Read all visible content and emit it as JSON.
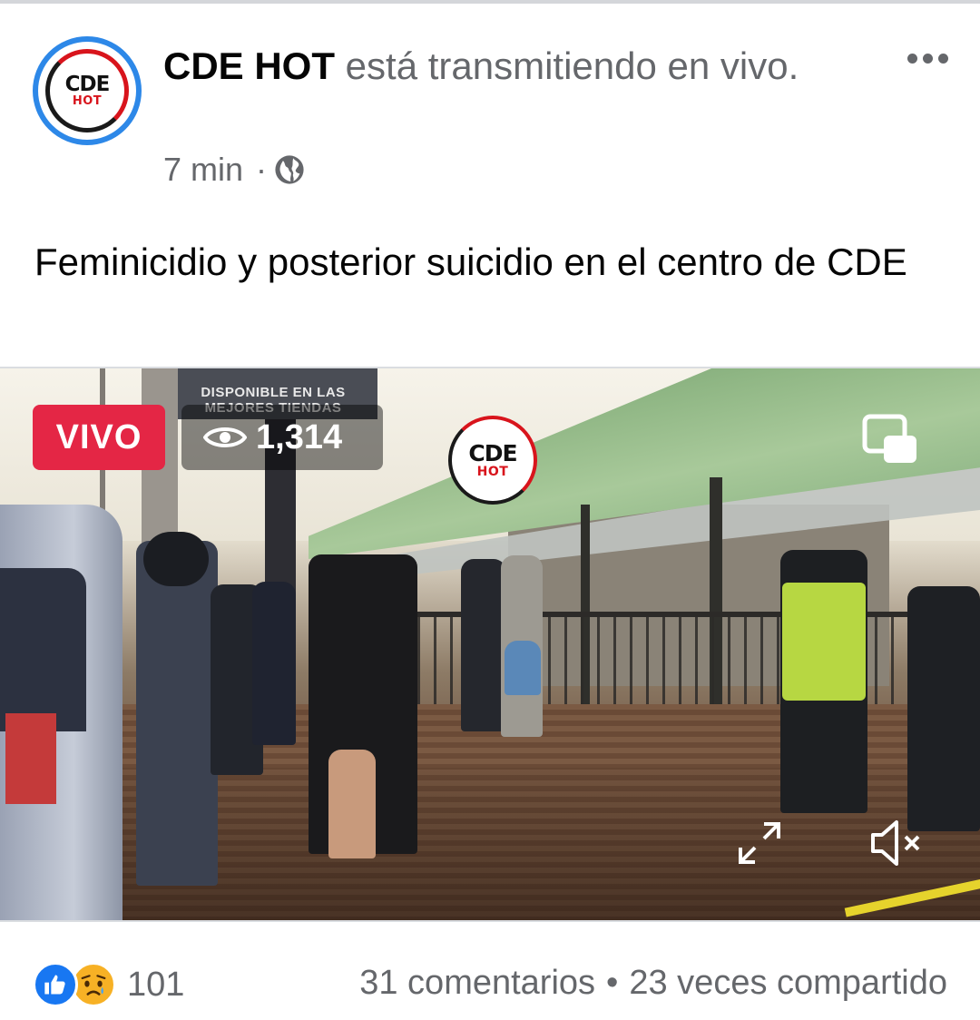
{
  "post": {
    "page_name": "CDE HOT",
    "status_text": " está transmitiendo en vivo.",
    "time": "7 min",
    "separator": "·",
    "privacy_icon": "globe-icon",
    "text": "Feminicidio y posterior suicidio en el centro de CDE",
    "avatar_logo": {
      "main": "CDE",
      "sub": "HOT"
    }
  },
  "video": {
    "live_label": "VIVO",
    "viewer_count": "1,314",
    "billboard_text": "DISPONIBLE EN LAS MEJORES TIENDAS",
    "watermark": {
      "main": "CDE",
      "sub": "HOT"
    },
    "icons": [
      "eye-icon",
      "picture-in-picture-icon",
      "expand-icon",
      "mute-icon"
    ]
  },
  "footer": {
    "reaction_icons": [
      "like-icon",
      "sad-icon"
    ],
    "reaction_count": "101",
    "comments": "31 comentarios",
    "dot": "•",
    "shares": "23 veces compartido"
  },
  "colors": {
    "live_red": "#e42645",
    "facebook_blue": "#1877f2",
    "avatar_ring": "#2d88e8",
    "secondary_text": "#65676b"
  }
}
